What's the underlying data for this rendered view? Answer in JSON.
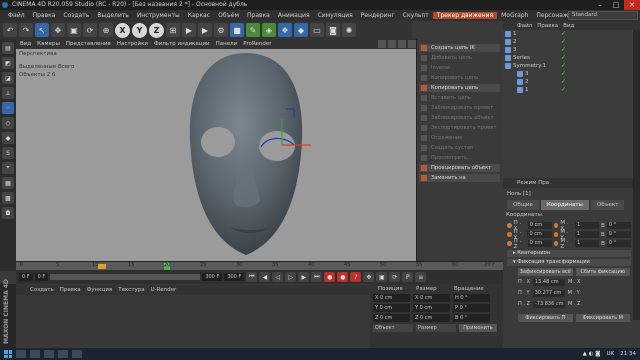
{
  "window": {
    "title": "CINEMA 4D R20.059 Studio (RC - R20) - [Без названия 2 *] - Основной дубль",
    "min": "–",
    "max": "□",
    "close": "✕"
  },
  "menubar": [
    "Файл",
    "Правка",
    "Создать",
    "Выделить",
    "Инструменты",
    "Каркас",
    "Объём",
    "Правка",
    "Анимация",
    "Симуляция",
    "Рендеринг",
    "Скульпт",
    "Трекер движения",
    "MoGraph",
    "Персонаж",
    "Производство"
  ],
  "menubar_highlight": "Трекер движения",
  "layout": "Standard",
  "toolbar": {
    "x": "X",
    "y": "Y",
    "z": "Z"
  },
  "viewport": {
    "menu": [
      "Вид",
      "Камеры",
      "Представление",
      "Настройки",
      "Фильтр индикации",
      "Панели",
      "ProRender"
    ],
    "label": "Перспектива",
    "stats_label": "Выделенные Всего",
    "stats_objects": "Объекты  2        6"
  },
  "context_panel": [
    {
      "label": "Создать цепь IK",
      "on": true
    },
    {
      "label": "Добавить цель",
      "on": false
    },
    {
      "label": "Inverse",
      "on": false
    },
    {
      "label": "Копировать цепь",
      "on": false
    },
    {
      "label": "Копировать цепь",
      "on": true
    },
    {
      "label": "Вставить цепь",
      "on": false
    },
    {
      "label": "Заблокировать проект",
      "on": false
    },
    {
      "label": "Заблокировать объект",
      "on": false
    },
    {
      "label": "Экспортировать проект",
      "on": false
    },
    {
      "label": "Отражение",
      "on": false
    },
    {
      "label": "Создать сустав",
      "on": false
    },
    {
      "label": "Просмотреть...",
      "on": false
    },
    {
      "label": "Проецировать объект",
      "on": true
    },
    {
      "label": "Заменить на",
      "on": true
    }
  ],
  "objects": {
    "menu": [
      "Файл",
      "Правка",
      "Вид"
    ],
    "rows": [
      {
        "name": "1",
        "indent": 0
      },
      {
        "name": "2",
        "indent": 0
      },
      {
        "name": "3",
        "indent": 0
      },
      {
        "name": "Series",
        "indent": 0
      },
      {
        "name": "Symmetry.1",
        "indent": 0
      },
      {
        "name": "3",
        "indent": 1
      },
      {
        "name": "2",
        "indent": 1
      },
      {
        "name": "1",
        "indent": 1
      }
    ]
  },
  "attributes": {
    "header": "Режим   Пра",
    "object": "Ноль [1]",
    "tabs": [
      "Общие",
      "Координаты",
      "Объект"
    ],
    "active_tab": "Координаты",
    "section": "Координаты",
    "coords": [
      {
        "a": "П . X",
        "av": "0 cm",
        "b": "М . X",
        "bv": "1",
        "c": "В",
        "cv": "0 °"
      },
      {
        "a": "П . Y",
        "av": "0 cm",
        "b": "М . Y",
        "bv": "1",
        "c": "В",
        "cv": "0 °"
      },
      {
        "a": "П . Z",
        "av": "0 cm",
        "b": "М . Z",
        "bv": "1",
        "c": "В",
        "cv": "0 °"
      }
    ],
    "quat": "▸ Кватернион",
    "freeze": "▾ Фиксация трансформации",
    "freeze_all": "Зафиксировать всё",
    "reset": "Сбить фиксацию",
    "frozen": [
      {
        "a": "П . X",
        "av": "13.48 cm",
        "b": "М . X"
      },
      {
        "a": "П . Y",
        "av": "30.277 cm",
        "b": "М . Y"
      },
      {
        "a": "П . Z",
        "av": "-73.836 cm",
        "b": "М . Z"
      }
    ],
    "freeze_p": "Фиксировать П",
    "freeze_m": "Фиксировать М"
  },
  "timeline": {
    "ticks": [
      "0",
      "5",
      "10",
      "15",
      "20",
      "25",
      "30",
      "35",
      "40",
      "45",
      "50",
      "55",
      "60"
    ],
    "end_label": "20 F"
  },
  "transport": {
    "start": "0 F",
    "current": "0 F",
    "end": "300 F",
    "end2": "300 F"
  },
  "materials": {
    "menu": [
      "Создать",
      "Правка",
      "Функция",
      "Текстура",
      "U-Render"
    ]
  },
  "coordinates": {
    "headers": [
      "Позиция",
      "Размер",
      "Вращение"
    ],
    "rows": [
      {
        "p": "X   0 cm",
        "s": "X   0 cm",
        "r": "H   0 °"
      },
      {
        "p": "Y   0 cm",
        "s": "Y   0 cm",
        "r": "P   0 °"
      },
      {
        "p": "Z   0 cm",
        "s": "Z   0 cm",
        "r": "B   0 °"
      }
    ],
    "mode1": "Объект",
    "mode2": "Размер",
    "apply": "Применить"
  },
  "brand": "MAXON CINEMA 4D",
  "taskbar": {
    "lang": "UK",
    "time": "21:34"
  }
}
